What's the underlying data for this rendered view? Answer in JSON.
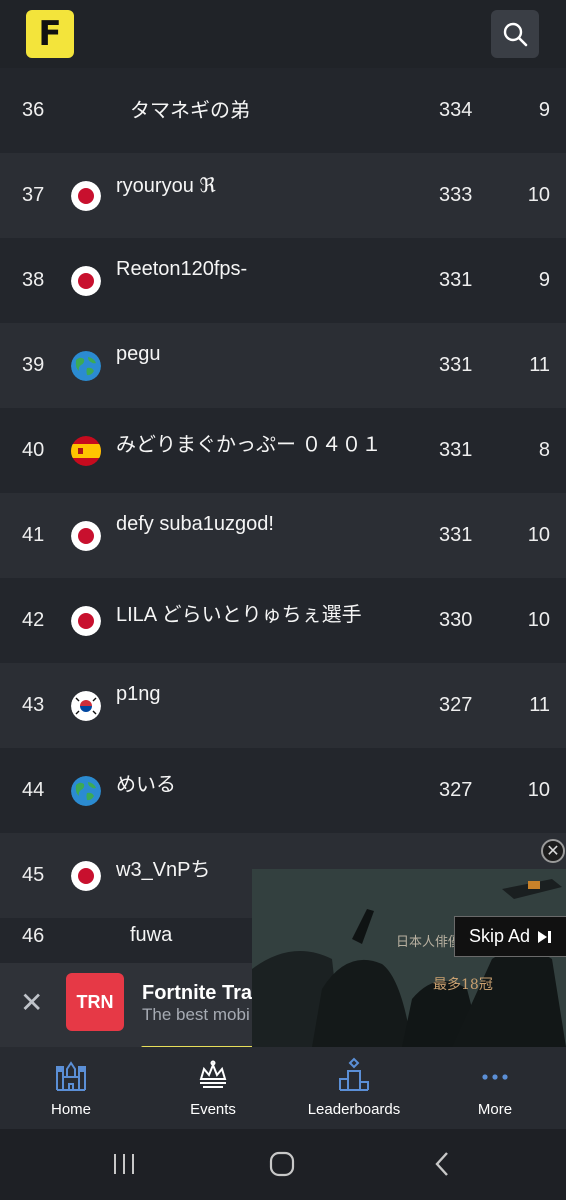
{
  "app": {
    "logo_letter": "F",
    "accent": "#f3e43b"
  },
  "header": {
    "search_icon": "search-icon"
  },
  "leaderboard": {
    "rows": [
      {
        "rank": "36",
        "flag": "none",
        "name": "タマネギの弟",
        "points": "334",
        "matches": "9"
      },
      {
        "rank": "37",
        "flag": "japan",
        "name": "ryouryou ℜ",
        "points": "333",
        "matches": "10"
      },
      {
        "rank": "38",
        "flag": "japan",
        "name": "Reeton120fps-",
        "points": "331",
        "matches": "9"
      },
      {
        "rank": "39",
        "flag": "world",
        "name": "pegu",
        "points": "331",
        "matches": "11"
      },
      {
        "rank": "40",
        "flag": "spain",
        "name": "みどりまぐかっぷー ０４０１",
        "points": "331",
        "matches": "8"
      },
      {
        "rank": "41",
        "flag": "japan",
        "name": "defy suba1uzgod!",
        "points": "331",
        "matches": "10"
      },
      {
        "rank": "42",
        "flag": "japan",
        "name": "LILA どらいとりゅちぇ選手",
        "points": "330",
        "matches": "10"
      },
      {
        "rank": "43",
        "flag": "korea",
        "name": "p1ng",
        "points": "327",
        "matches": "11"
      },
      {
        "rank": "44",
        "flag": "world",
        "name": "めいる",
        "points": "327",
        "matches": "10"
      },
      {
        "rank": "45",
        "flag": "japan",
        "name": "w3_VnPち",
        "points": "",
        "matches": ""
      },
      {
        "rank": "46",
        "flag": "none",
        "name": "fuwa",
        "points": "",
        "matches": ""
      }
    ]
  },
  "banner": {
    "logo_text": "TRN",
    "title": "Fortnite Trac",
    "subtitle": "The best mobi",
    "close_label": "✕"
  },
  "video_ad": {
    "skip_label": "Skip Ad",
    "close_label": "✕",
    "text1": "日本人俳優",
    "text2": "最多18冠"
  },
  "bottom_nav": {
    "items": [
      {
        "label": "Home",
        "icon": "castle-icon"
      },
      {
        "label": "Events",
        "icon": "crown-icon"
      },
      {
        "label": "Leaderboards",
        "icon": "podium-icon"
      },
      {
        "label": "More",
        "icon": "dots-icon"
      }
    ]
  },
  "system_nav": {
    "icons": [
      "recent-apps-icon",
      "home-icon",
      "back-icon"
    ]
  }
}
